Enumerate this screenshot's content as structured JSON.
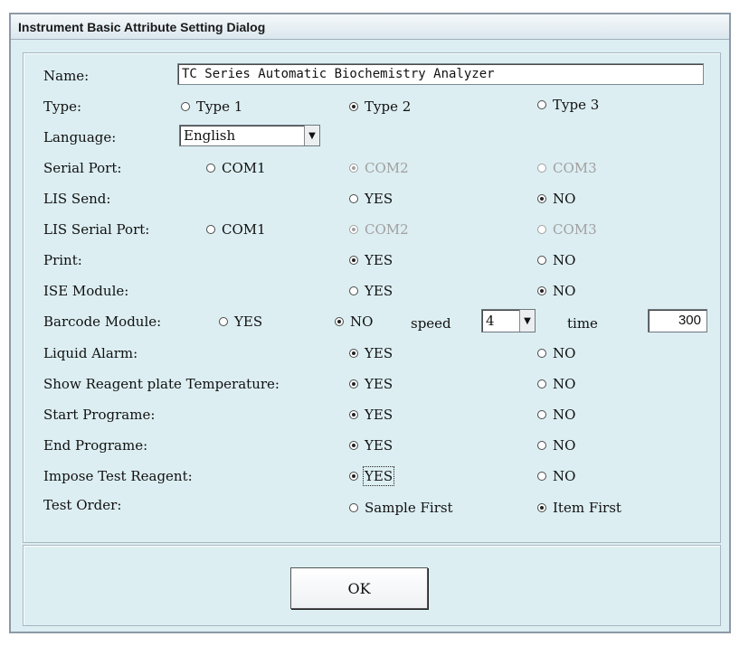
{
  "dialog": {
    "title": "Instrument Basic Attribute Setting Dialog"
  },
  "rows": {
    "name": {
      "label": "Name:",
      "value": "TC Series Automatic Biochemistry Analyzer"
    },
    "type": {
      "label": "Type:",
      "opt1": "Type 1",
      "opt2": "Type 2",
      "opt3": "Type 3",
      "selected": "Type 2"
    },
    "language": {
      "label": "Language:",
      "value": "English"
    },
    "serial_port": {
      "label": "Serial Port:",
      "opt1": "COM1",
      "opt2": "COM2",
      "opt3": "COM3",
      "selected": "COM2"
    },
    "lis_send": {
      "label": "LIS Send:",
      "yes": "YES",
      "no": "NO",
      "selected": "NO"
    },
    "lis_serial_port": {
      "label": "LIS Serial Port:",
      "opt1": "COM1",
      "opt2": "COM2",
      "opt3": "COM3",
      "selected": "COM2"
    },
    "print": {
      "label": "Print:",
      "yes": "YES",
      "no": "NO",
      "selected": "YES"
    },
    "ise_module": {
      "label": "ISE Module:",
      "yes": "YES",
      "no": "NO",
      "selected": "NO"
    },
    "barcode_module": {
      "label": "Barcode Module:",
      "yes": "YES",
      "no": "NO",
      "selected": "NO",
      "speed_label": "speed",
      "speed_value": "4",
      "time_label": "time",
      "time_value": "300"
    },
    "liquid_alarm": {
      "label": "Liquid Alarm:",
      "yes": "YES",
      "no": "NO",
      "selected": "YES"
    },
    "reagent_temp": {
      "label": "Show Reagent plate Temperature:",
      "yes": "YES",
      "no": "NO",
      "selected": "YES"
    },
    "start_program": {
      "label": "Start Programe:",
      "yes": "YES",
      "no": "NO",
      "selected": "YES"
    },
    "end_program": {
      "label": "End Programe:",
      "yes": "YES",
      "no": "NO",
      "selected": "YES"
    },
    "impose_test_reagent": {
      "label": "Impose Test Reagent:",
      "yes": "YES",
      "no": "NO",
      "selected": "YES"
    },
    "test_order": {
      "label": "Test Order:",
      "opt1": "Sample First",
      "opt2": "Item First",
      "selected": "Item First"
    }
  },
  "buttons": {
    "ok": "OK"
  },
  "icons": {
    "dropdown": "chevron-down-icon",
    "radio": "radio-icon"
  }
}
